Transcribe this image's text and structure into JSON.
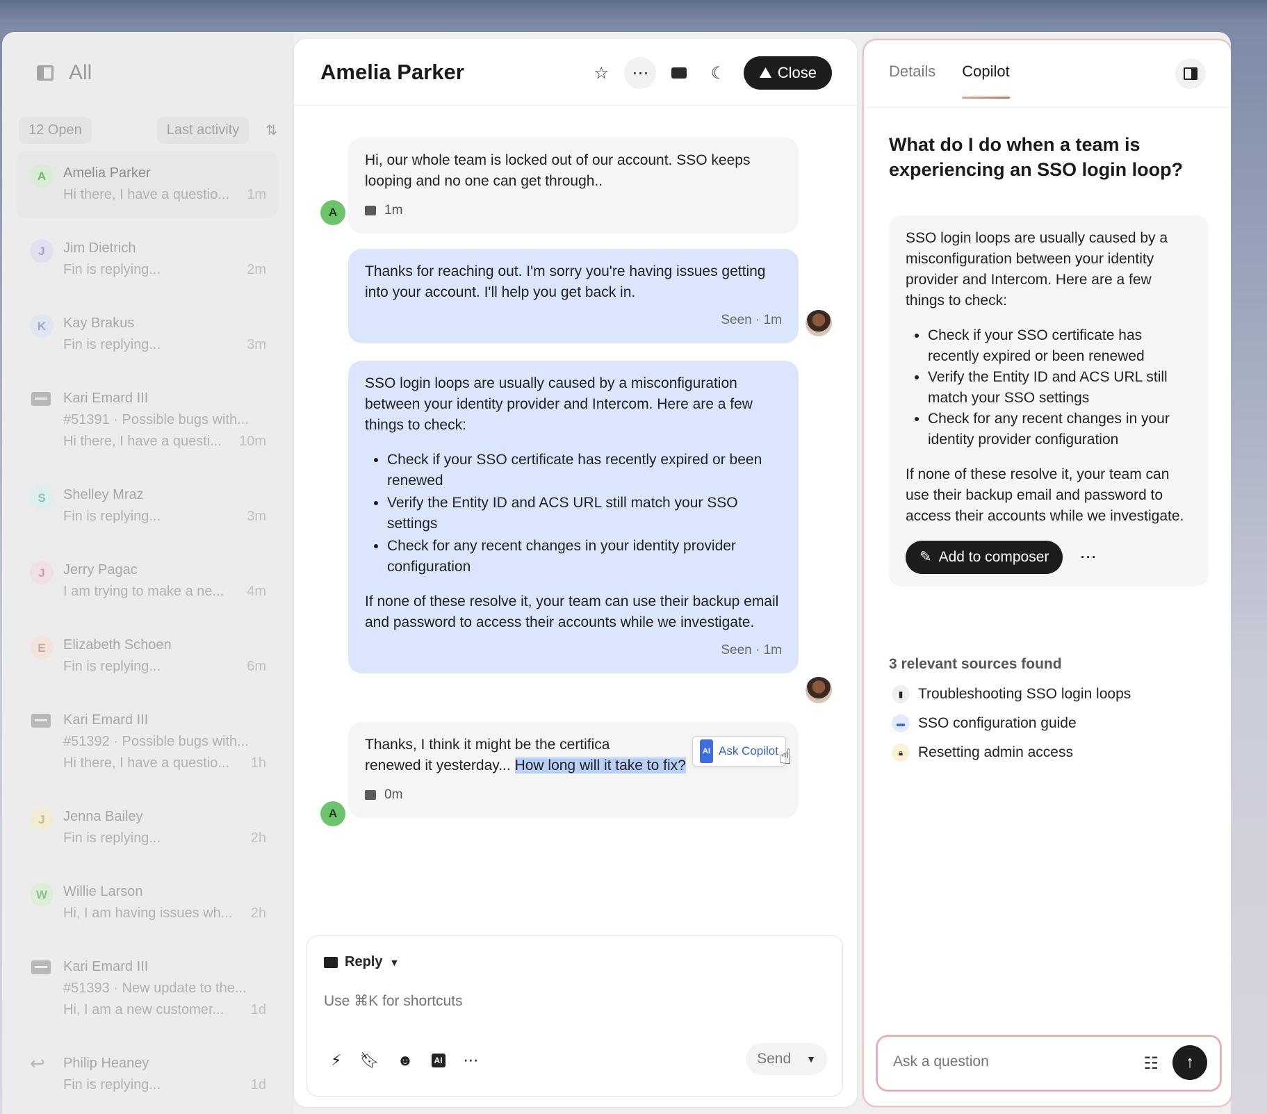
{
  "sidebar": {
    "title": "All",
    "open_count": "12 Open",
    "sort_label": "Last activity",
    "conversations": [
      {
        "initial": "A",
        "name": "Amelia Parker",
        "preview": "Hi there, I have a questio...",
        "time": "1m",
        "avatar_color": "#d8ecd6",
        "initial_color": "#7fb27b",
        "type": "avatar"
      },
      {
        "initial": "J",
        "name": "Jim Dietrich",
        "preview": "Fin is replying...",
        "time": "2m",
        "avatar_color": "#e2e0f0",
        "initial_color": "#a7a2c9",
        "type": "avatar"
      },
      {
        "initial": "K",
        "name": "Kay Brakus",
        "preview": "Fin is replying...",
        "time": "3m",
        "avatar_color": "#e0e5f0",
        "initial_color": "#9aa8c7",
        "type": "avatar"
      },
      {
        "name": "Kari Emard III",
        "line2": "#51391 · Possible bugs with...",
        "preview": "Hi there, I have a questi...",
        "time": "10m",
        "type": "ticket"
      },
      {
        "initial": "S",
        "name": "Shelley Mraz",
        "preview": "Fin is replying...",
        "time": "3m",
        "avatar_color": "#dcefee",
        "initial_color": "#8ec2bd",
        "type": "avatar"
      },
      {
        "initial": "J",
        "name": "Jerry Pagac",
        "preview": "I am trying to make a ne...",
        "time": "4m",
        "avatar_color": "#f0e0e6",
        "initial_color": "#c9a0ae",
        "type": "avatar"
      },
      {
        "initial": "E",
        "name": "Elizabeth Schoen",
        "preview": "Fin is replying...",
        "time": "6m",
        "avatar_color": "#f3e3dc",
        "initial_color": "#cfa596",
        "type": "avatar"
      },
      {
        "name": "Kari Emard III",
        "line2": "#51392 · Possible bugs with...",
        "preview": "Hi there, I have a questio...",
        "time": "1h",
        "type": "ticket"
      },
      {
        "initial": "J",
        "name": "Jenna Bailey",
        "preview": "Fin is replying...",
        "time": "2h",
        "avatar_color": "#f2ecd6",
        "initial_color": "#c9b784",
        "type": "avatar"
      },
      {
        "initial": "W",
        "name": "Willie Larson",
        "preview": "Hi, I am having issues wh...",
        "time": "2h",
        "avatar_color": "#dcefd6",
        "initial_color": "#94bf8a",
        "type": "avatar"
      },
      {
        "name": "Kari Emard III",
        "line2": "#51393 · New update to the...",
        "preview": "Hi, I am a new customer...",
        "time": "1d",
        "type": "ticket"
      },
      {
        "name": "Philip Heaney",
        "preview": "Fin is replying...",
        "time": "1d",
        "type": "reply"
      }
    ]
  },
  "main": {
    "title": "Amelia Parker",
    "close_label": "Close",
    "messages": {
      "m1": {
        "text": "Hi, our whole team is locked out of our account. SSO keeps looping and no one can get through..",
        "time": "1m",
        "author_initial": "A"
      },
      "m2": {
        "text": "Thanks for reaching out. I'm sorry you're having issues getting into your account. I'll help you get back in.",
        "seen": "Seen · 1m"
      },
      "m3": {
        "intro": "SSO login loops are usually caused by a misconfiguration between your identity provider and Intercom. Here are a few things to check:",
        "bullets": [
          "Check if your SSO certificate has recently expired or been renewed",
          "Verify the Entity ID and ACS URL still match your SSO settings",
          "Check for any recent changes in your identity provider configuration"
        ],
        "outro": "If none of these resolve it, your team can use their backup email and password to access their accounts while we investigate.",
        "seen": "Seen · 1m"
      },
      "m4": {
        "text_a": "Thanks, I think it might be the certifica",
        "text_b": "renewed it yesterday... ",
        "highlight": "How long will it take to fix?",
        "time": "0m",
        "author_initial": "A"
      }
    },
    "ask_copilot": {
      "badge": "AI",
      "label": "Ask Copilot"
    },
    "composer": {
      "mode": "Reply",
      "placeholder": "Use ⌘K for shortcuts",
      "send_label": "Send",
      "ai_badge": "AI"
    }
  },
  "right": {
    "tabs": [
      "Details",
      "Copilot"
    ],
    "question": "What do I do when a team is experiencing an SSO login loop?",
    "answer": {
      "intro": "SSO login loops are usually caused by a misconfiguration between your identity provider and Intercom. Here are a few things to check:",
      "bullets": [
        "Check if your SSO certificate has recently expired or been renewed",
        "Verify the Entity ID and ACS URL still match your SSO settings",
        "Check for any recent changes in your identity provider configuration"
      ],
      "outro": "If none of these resolve it, your team can use their backup email and password to access their accounts while we investigate."
    },
    "add_to_composer": "Add to composer",
    "sources_title": "3 relevant sources found",
    "sources": [
      {
        "label": "Troubleshooting SSO login loops",
        "icon": "article-icon",
        "color": "#222"
      },
      {
        "label": "SSO configuration guide",
        "icon": "message-icon",
        "color": "#3d6ee0"
      },
      {
        "label": "Resetting admin access",
        "icon": "lock-icon",
        "color": "#e0b43d"
      }
    ],
    "ask_placeholder": "Ask a question"
  }
}
